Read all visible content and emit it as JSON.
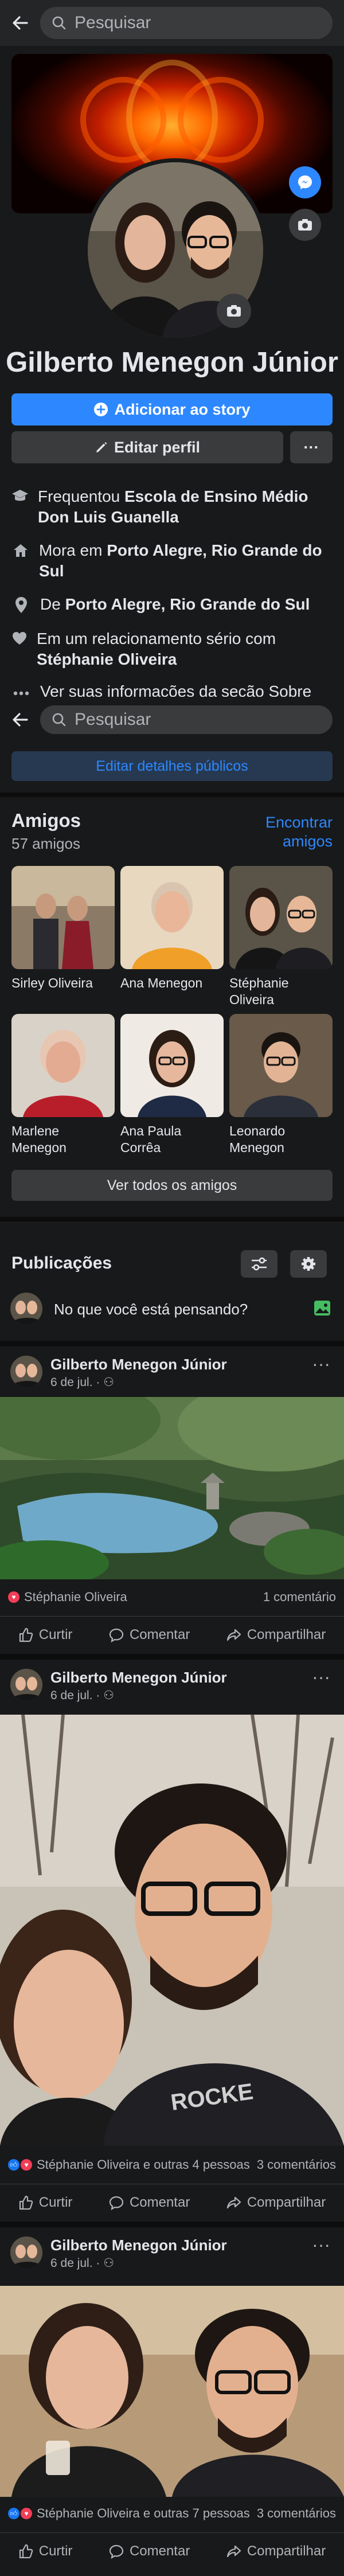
{
  "top_search": {
    "placeholder": "Pesquisar"
  },
  "profile": {
    "name": "Gilberto Menegon Júnior",
    "add_story": "Adicionar ao story",
    "edit_profile": "Editar perfil",
    "more": "···"
  },
  "intro": {
    "school_prefix": "Frequentou ",
    "school": "Escola de Ensino Médio Don Luis Guanella",
    "lives_prefix": "Mora em ",
    "lives": "Porto Alegre, Rio Grande do Sul",
    "from_prefix": "De ",
    "from": "Porto Alegre, Rio Grande do Sul",
    "relationship_prefix": "Em um relacionamento sério com ",
    "relationship": "Stéphanie Oliveira",
    "see_info": "Ver suas informações da seção Sobre"
  },
  "sticky_search": {
    "placeholder": "Pesquisar"
  },
  "edit_details": "Editar detalhes públicos",
  "friends": {
    "title": "Amigos",
    "count": "57 amigos",
    "find": "Encontrar amigos",
    "see_all": "Ver todos os amigos",
    "items": [
      {
        "name": "Sirley Oliveira"
      },
      {
        "name": "Ana Menegon"
      },
      {
        "name": "Stéphanie Oliveira"
      },
      {
        "name": "Marlene Menegon"
      },
      {
        "name": "Ana Paula Corrêa"
      },
      {
        "name": "Leonardo Menegon"
      }
    ]
  },
  "publications": {
    "title": "Publicações",
    "composer_placeholder": "No que você está pensando?"
  },
  "posts": [
    {
      "author": "Gilberto Menegon Júnior",
      "date": "6 de jul. ·",
      "reactions": "Stéphanie Oliveira",
      "comments": "1 comentário"
    },
    {
      "author": "Gilberto Menegon Júnior",
      "date": "6 de jul. ·",
      "reactions": "Stéphanie Oliveira e outras 4 pessoas",
      "comments": "3 comentários"
    },
    {
      "author": "Gilberto Menegon Júnior",
      "date": "6 de jul. ·",
      "reactions": "Stéphanie Oliveira e outras 7 pessoas",
      "comments": "3 comentários"
    }
  ],
  "actions": {
    "like": "Curtir",
    "comment": "Comentar",
    "share": "Compartilhar"
  },
  "colors": {
    "accent": "#2d88ff",
    "bg": "#18191a",
    "surface": "#3a3b3c",
    "like": "#1877f2",
    "love": "#f33e58"
  }
}
